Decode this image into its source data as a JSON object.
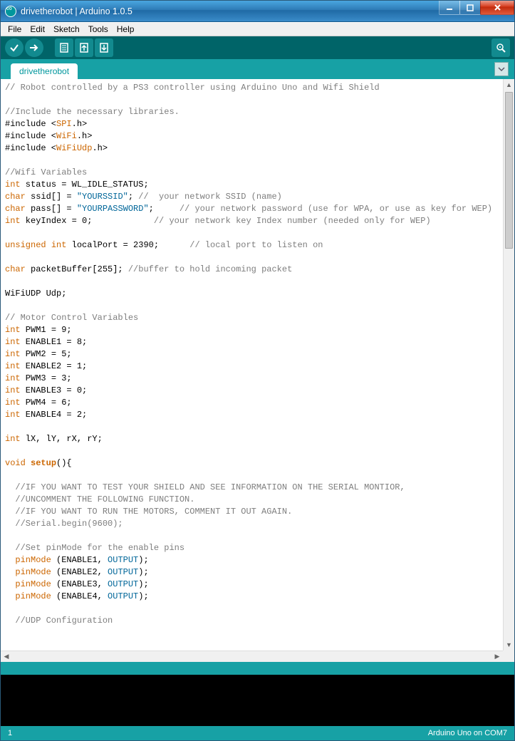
{
  "window": {
    "title": "drivetherobot | Arduino 1.0.5"
  },
  "menu": {
    "items": [
      "File",
      "Edit",
      "Sketch",
      "Tools",
      "Help"
    ]
  },
  "tabs": {
    "items": [
      "drivetherobot"
    ]
  },
  "status": {
    "line": "1",
    "board": "Arduino Uno on COM7"
  },
  "code": {
    "lines": [
      {
        "t": "comm",
        "v": "// Robot controlled by a PS3 controller using Arduino Uno and Wifi Shield"
      },
      {
        "t": "blank",
        "v": ""
      },
      {
        "t": "comm",
        "v": "//Include the necessary libraries."
      },
      {
        "t": "inc",
        "pre": "#include <",
        "lib": "SPI",
        "post": ".h>"
      },
      {
        "t": "inc",
        "pre": "#include <",
        "lib": "WiFi",
        "post": ".h>"
      },
      {
        "t": "inc",
        "pre": "#include <",
        "lib": "WiFiUdp",
        "post": ".h>"
      },
      {
        "t": "blank",
        "v": ""
      },
      {
        "t": "comm",
        "v": "//Wifi Variables"
      },
      {
        "t": "decl",
        "kw": "int",
        "rest": " status = WL_IDLE_STATUS;"
      },
      {
        "t": "declstr",
        "kw": "char",
        "mid": " ssid[] = ",
        "str": "\"YOURSSID\"",
        "after": "; //  your network SSID (name)",
        "aftercomm": true
      },
      {
        "t": "declstr",
        "kw": "char",
        "mid": " pass[] = ",
        "str": "\"YOURPASSWORD\"",
        "after": ";     // your network password (use for WPA, or use as key for WEP)",
        "aftercomm": true
      },
      {
        "t": "declc",
        "kw": "int",
        "mid": " keyIndex = 0;            ",
        "comm": "// your network key Index number (needed only for WEP)"
      },
      {
        "t": "blank",
        "v": ""
      },
      {
        "t": "decl2",
        "kw1": "unsigned",
        "kw2": "int",
        "rest": " localPort = 2390;      ",
        "comm": "// local port to listen on"
      },
      {
        "t": "blank",
        "v": ""
      },
      {
        "t": "declc",
        "kw": "char",
        "mid": " packetBuffer[255]; ",
        "comm": "//buffer to hold incoming packet"
      },
      {
        "t": "blank",
        "v": ""
      },
      {
        "t": "plain",
        "v": "WiFiUDP Udp;"
      },
      {
        "t": "blank",
        "v": ""
      },
      {
        "t": "comm",
        "v": "// Motor Control Variables"
      },
      {
        "t": "decl",
        "kw": "int",
        "rest": " PWM1 = 9;"
      },
      {
        "t": "decl",
        "kw": "int",
        "rest": " ENABLE1 = 8;"
      },
      {
        "t": "decl",
        "kw": "int",
        "rest": " PWM2 = 5;"
      },
      {
        "t": "decl",
        "kw": "int",
        "rest": " ENABLE2 = 1;"
      },
      {
        "t": "decl",
        "kw": "int",
        "rest": " PWM3 = 3;"
      },
      {
        "t": "decl",
        "kw": "int",
        "rest": " ENABLE3 = 0;"
      },
      {
        "t": "decl",
        "kw": "int",
        "rest": " PWM4 = 6;"
      },
      {
        "t": "decl",
        "kw": "int",
        "rest": " ENABLE4 = 2;"
      },
      {
        "t": "blank",
        "v": ""
      },
      {
        "t": "decl",
        "kw": "int",
        "rest": " lX, lY, rX, rY;"
      },
      {
        "t": "blank",
        "v": ""
      },
      {
        "t": "func",
        "kw": "void",
        "name": "setup",
        "rest": "(){"
      },
      {
        "t": "blank",
        "v": ""
      },
      {
        "t": "icomm",
        "v": "  //IF YOU WANT TO TEST YOUR SHIELD AND SEE INFORMATION ON THE SERIAL MONTIOR,"
      },
      {
        "t": "icomm",
        "v": "  //UNCOMMENT THE FOLLOWING FUNCTION."
      },
      {
        "t": "icomm",
        "v": "  //IF YOU WANT TO RUN THE MOTORS, COMMENT IT OUT AGAIN."
      },
      {
        "t": "icomm",
        "v": "  //Serial.begin(9600);"
      },
      {
        "t": "blank",
        "v": ""
      },
      {
        "t": "icomm",
        "v": "  //Set pinMode for the enable pins"
      },
      {
        "t": "call",
        "ind": "  ",
        "fn": "pinMode",
        "mid": " (ENABLE1, ",
        "c": "OUTPUT",
        "end": ");"
      },
      {
        "t": "call",
        "ind": "  ",
        "fn": "pinMode",
        "mid": " (ENABLE2, ",
        "c": "OUTPUT",
        "end": ");"
      },
      {
        "t": "call",
        "ind": "  ",
        "fn": "pinMode",
        "mid": " (ENABLE3, ",
        "c": "OUTPUT",
        "end": ");"
      },
      {
        "t": "call",
        "ind": "  ",
        "fn": "pinMode",
        "mid": " (ENABLE4, ",
        "c": "OUTPUT",
        "end": ");"
      },
      {
        "t": "blank",
        "v": ""
      },
      {
        "t": "icomm",
        "v": "  //UDP Configuration"
      }
    ]
  }
}
